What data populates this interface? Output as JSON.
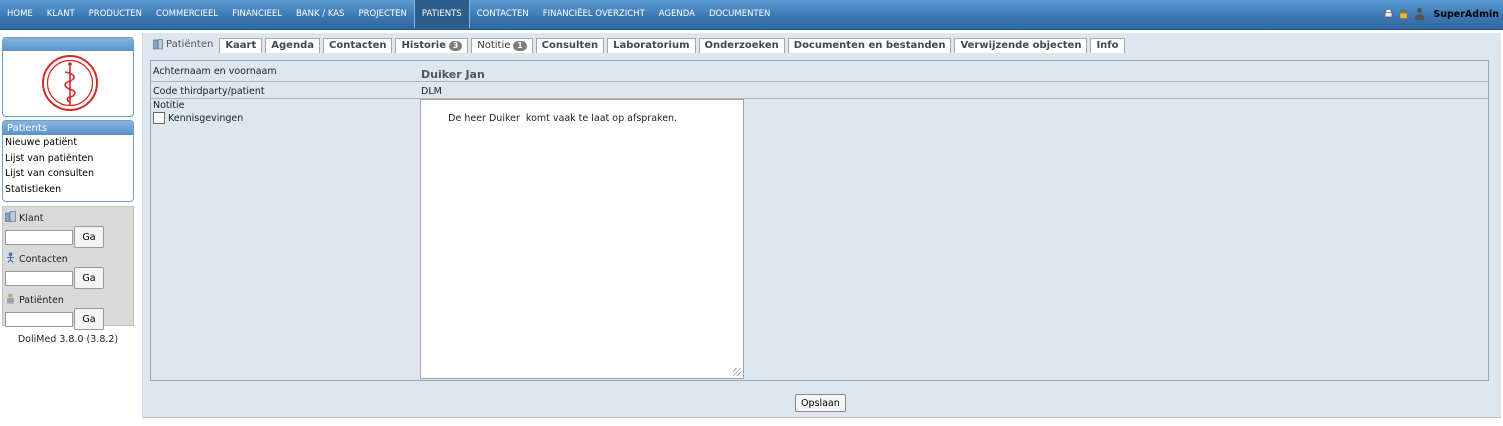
{
  "topnav": [
    "Home",
    "Klant",
    "Producten",
    "Commercieel",
    "Financieel",
    "Bank / Kas",
    "Projecten",
    "Patients",
    "Contacten",
    "Financiëel overzicht",
    "Agenda",
    "Documenten"
  ],
  "active_nav": "Patients",
  "user": {
    "name": "SuperAdmin",
    "icons": [
      "print-icon",
      "lock-icon",
      "user-icon"
    ]
  },
  "sidebar": {
    "logo": "caduceus-logo",
    "menu_title": "Patients",
    "menu_items": [
      "Nieuwe patiënt",
      "Lijst van patiënten",
      "Lijst van consulten",
      "Statistieken"
    ],
    "searches": [
      {
        "label": "Klant",
        "button": "Ga",
        "icon": "building-icon"
      },
      {
        "label": "Contacten",
        "button": "Ga",
        "icon": "person-icon"
      },
      {
        "label": "Patiënten",
        "button": "Ga",
        "icon": "patient-icon"
      }
    ],
    "version": "DoliMed 3.8.0 (3.8.2)"
  },
  "tabs": {
    "first": "Patiënten",
    "items": [
      {
        "label": "Kaart"
      },
      {
        "label": "Agenda"
      },
      {
        "label": "Contacten"
      },
      {
        "label": "Historie",
        "badge": "3"
      },
      {
        "label": "Notitie",
        "badge": "1",
        "active": true
      },
      {
        "label": "Consulten"
      },
      {
        "label": "Laboratorium"
      },
      {
        "label": "Onderzoeken"
      },
      {
        "label": "Documenten en bestanden"
      },
      {
        "label": "Verwijzende objecten"
      },
      {
        "label": "Info"
      }
    ]
  },
  "form": {
    "name_label": "Achternaam en voornaam",
    "name_value": "Duiker Jan",
    "code_label": "Code thirdparty/patient",
    "code_value": "DLM",
    "note_label": "Notitie",
    "notif_label": "Kennisgevingen",
    "note_text": "De heer Duiker  komt vaak te laat op afspraken.",
    "save_label": "Opslaan"
  },
  "colors": {
    "topbar": "#3e79b5",
    "content_bg": "#dee7ef",
    "logo_red": "#d62828"
  }
}
